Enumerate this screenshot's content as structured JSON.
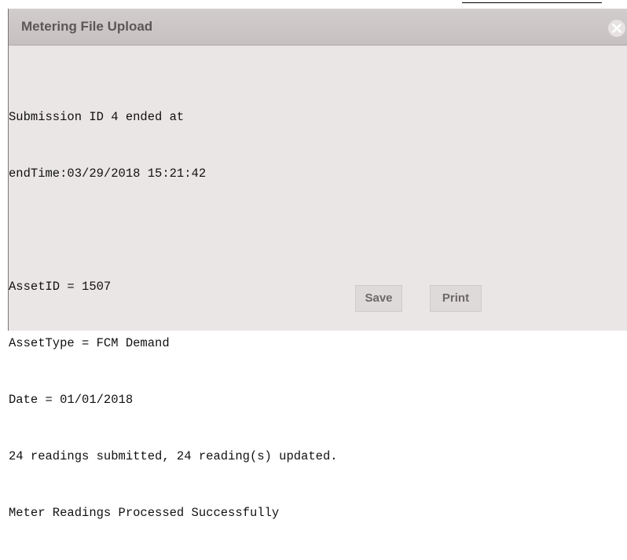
{
  "dialog": {
    "title": "Metering File Upload",
    "close_icon": "close-icon"
  },
  "result": {
    "lines": [
      "Submission ID 4 ended at",
      "endTime:03/29/2018 15:21:42",
      "",
      "AssetID = 1507",
      "AssetType = FCM Demand",
      "Date = 01/01/2018",
      "24 readings submitted, 24 reading(s) updated.",
      "Meter Readings Processed Successfully"
    ]
  },
  "actions": {
    "save_label": "Save",
    "print_label": "Print"
  },
  "colors": {
    "dialog_bg": "#ebe6e6",
    "titlebar_bg": "#cbc5c5",
    "title_text": "#5d5757",
    "button_text": "#6d6767",
    "close_icon": "#ffffff"
  }
}
